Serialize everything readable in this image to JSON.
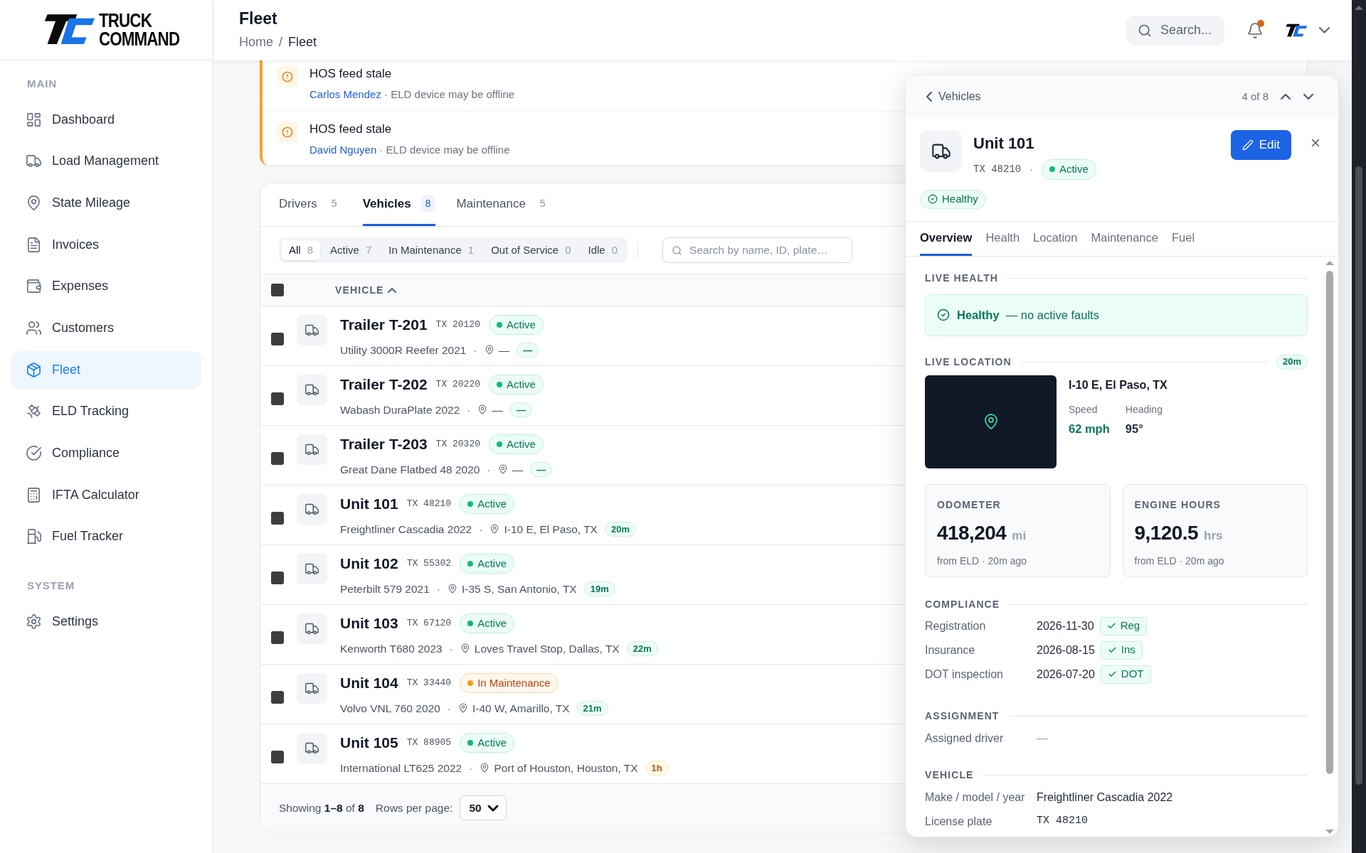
{
  "brand": {
    "line1": "TRUCK",
    "line2": "COMMAND"
  },
  "sidebar": {
    "sections": [
      {
        "title": "MAIN",
        "items": [
          {
            "label": "Dashboard",
            "selected": false
          },
          {
            "label": "Load Management",
            "selected": false
          },
          {
            "label": "State Mileage",
            "selected": false
          },
          {
            "label": "Invoices",
            "selected": false
          },
          {
            "label": "Expenses",
            "selected": false
          },
          {
            "label": "Customers",
            "selected": false
          },
          {
            "label": "Fleet",
            "selected": true
          },
          {
            "label": "ELD Tracking",
            "selected": false
          },
          {
            "label": "Compliance",
            "selected": false
          },
          {
            "label": "IFTA Calculator",
            "selected": false
          },
          {
            "label": "Fuel Tracker",
            "selected": false
          }
        ]
      },
      {
        "title": "SYSTEM",
        "items": [
          {
            "label": "Settings",
            "selected": false
          }
        ]
      }
    ]
  },
  "header": {
    "title": "Fleet",
    "breadcrumb": [
      "Home",
      "Fleet"
    ],
    "breadcrumb_sep": "/",
    "search": {
      "placeholder": "Search..."
    },
    "notifications": {
      "unread": true
    }
  },
  "alerts": [
    {
      "title": "HOS feed stale",
      "driver": "Carlos Mendez",
      "detail": "· ELD device may be offline"
    },
    {
      "title": "HOS feed stale",
      "driver": "David Nguyen",
      "detail": "· ELD device may be offline"
    }
  ],
  "tabs": [
    {
      "label": "Drivers",
      "count": "5",
      "selected": false
    },
    {
      "label": "Vehicles",
      "count": "8",
      "selected": true
    },
    {
      "label": "Maintenance",
      "count": "5",
      "selected": false
    }
  ],
  "filters": [
    {
      "label": "All",
      "count": "8",
      "selected": true
    },
    {
      "label": "Active",
      "count": "7",
      "selected": false
    },
    {
      "label": "In Maintenance",
      "count": "1",
      "selected": false
    },
    {
      "label": "Out of Service",
      "count": "0",
      "selected": false
    },
    {
      "label": "Idle",
      "count": "0",
      "selected": false
    }
  ],
  "table_search": {
    "placeholder": "Search by name, ID, plate…"
  },
  "select_all": {
    "checked": false
  },
  "column": "VEHICLE",
  "rows": [
    {
      "checked": false,
      "name": "Trailer T-201",
      "plate": "TX 20120",
      "status": {
        "label": "Active",
        "kind": "active"
      },
      "model": "Utility 3000R Reefer 2021",
      "sep": "·",
      "location": "—",
      "age": {
        "label": "—",
        "kind": "fresh"
      }
    },
    {
      "checked": false,
      "name": "Trailer T-202",
      "plate": "TX 20220",
      "status": {
        "label": "Active",
        "kind": "active"
      },
      "model": "Wabash DuraPlate 2022",
      "sep": "·",
      "location": "—",
      "age": {
        "label": "—",
        "kind": "fresh"
      }
    },
    {
      "checked": false,
      "name": "Trailer T-203",
      "plate": "TX 20320",
      "status": {
        "label": "Active",
        "kind": "active"
      },
      "model": "Great Dane Flatbed 48 2020",
      "sep": "·",
      "location": "—",
      "age": {
        "label": "—",
        "kind": "fresh"
      }
    },
    {
      "checked": false,
      "name": "Unit 101",
      "plate": "TX 48210",
      "status": {
        "label": "Active",
        "kind": "active"
      },
      "model": "Freightliner Cascadia 2022",
      "sep": "·",
      "location": "I-10 E, El Paso, TX",
      "age": {
        "label": "20m",
        "kind": "fresh"
      }
    },
    {
      "checked": false,
      "name": "Unit 102",
      "plate": "TX 55302",
      "status": {
        "label": "Active",
        "kind": "active"
      },
      "model": "Peterbilt 579 2021",
      "sep": "·",
      "location": "I-35 S, San Antonio, TX",
      "age": {
        "label": "19m",
        "kind": "fresh"
      }
    },
    {
      "checked": false,
      "name": "Unit 103",
      "plate": "TX 67120",
      "status": {
        "label": "Active",
        "kind": "active"
      },
      "model": "Kenworth T680 2023",
      "sep": "·",
      "location": "Loves Travel Stop, Dallas, TX",
      "age": {
        "label": "22m",
        "kind": "fresh"
      }
    },
    {
      "checked": false,
      "name": "Unit 104",
      "plate": "TX 33440",
      "status": {
        "label": "In Maintenance",
        "kind": "maintenance"
      },
      "model": "Volvo VNL 760 2020",
      "sep": "·",
      "location": "I-40 W, Amarillo, TX",
      "age": {
        "label": "21m",
        "kind": "fresh"
      }
    },
    {
      "checked": false,
      "name": "Unit 105",
      "plate": "TX 88905",
      "status": {
        "label": "Active",
        "kind": "active"
      },
      "model": "International LT625 2022",
      "sep": "·",
      "location": "Port of Houston, Houston, TX",
      "age": {
        "label": "1h",
        "kind": "stale"
      }
    }
  ],
  "footer": {
    "showing": "Showing **1–8** of **8**",
    "rows_per_page_label": "Rows per page:",
    "rows_per_page": "50"
  },
  "panel": {
    "back": "Vehicles",
    "position": "4 of 8",
    "title": "Unit 101",
    "plate": "TX 48210",
    "sep": "·",
    "status": {
      "label": "Active",
      "kind": "active"
    },
    "health": "Healthy",
    "edit": "Edit",
    "tabs": [
      {
        "label": "Overview",
        "selected": true
      },
      {
        "label": "Health",
        "selected": false
      },
      {
        "label": "Location",
        "selected": false
      },
      {
        "label": "Maintenance",
        "selected": false
      },
      {
        "label": "Fuel",
        "selected": false
      }
    ],
    "live_health": {
      "label": "LIVE HEALTH",
      "status": "Healthy",
      "detail": "— no active faults"
    },
    "live_location": {
      "label": "LIVE LOCATION",
      "age": {
        "label": "20m",
        "kind": "fresh"
      },
      "address": "I-10 E, El Paso, TX",
      "speed_label": "Speed",
      "speed": "62 mph",
      "heading_label": "Heading",
      "heading": "95°"
    },
    "stats": [
      {
        "label": "ODOMETER",
        "value": "418,204",
        "unit": "mi",
        "note": "from ELD · 20m ago"
      },
      {
        "label": "ENGINE HOURS",
        "value": "9,120.5",
        "unit": "hrs",
        "note": "from ELD · 20m ago"
      }
    ],
    "compliance": {
      "label": "COMPLIANCE",
      "items": [
        {
          "label": "Registration",
          "date": "2026-11-30",
          "badge": "Reg",
          "ok": true
        },
        {
          "label": "Insurance",
          "date": "2026-08-15",
          "badge": "Ins",
          "ok": true
        },
        {
          "label": "DOT inspection",
          "date": "2026-07-20",
          "badge": "DOT",
          "ok": true
        }
      ]
    },
    "assignment": {
      "label": "ASSIGNMENT",
      "rows": [
        {
          "label": "Assigned driver",
          "value": "—",
          "kind": "empty"
        }
      ]
    },
    "vehicle": {
      "label": "VEHICLE",
      "rows": [
        {
          "label": "Make / model / year",
          "value": "Freightliner Cascadia 2022",
          "kind": "text"
        },
        {
          "label": "License plate",
          "value": "TX 48210",
          "kind": "mono"
        }
      ]
    }
  }
}
